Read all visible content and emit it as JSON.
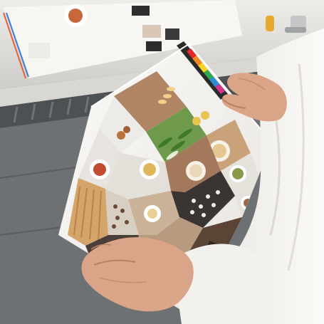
{
  "scene": {
    "description_tags": [
      "press-proof",
      "printed-sheet",
      "hands",
      "food-photography-collage"
    ],
    "palette": {
      "table_light": "#e9e7e3",
      "table_dark": "#5e6163",
      "sleeve": "#f3f1ee",
      "skin": "#d9a487",
      "skin_shadow": "#b97f63",
      "paper": "#f7f5f2",
      "wood": "#b08565",
      "wood_dark": "#8d6248",
      "slate": "#3a3533"
    },
    "color_bar": [
      "#e8262a",
      "#f08a24",
      "#f6d426",
      "#2fa84f",
      "#2a8fd6",
      "#5a3fa6",
      "#d6338c",
      "#1a1a1a",
      "#cfcfcf"
    ],
    "tiles": [
      {
        "name": "photo-tile-cutting-board",
        "color": "#b08565"
      },
      {
        "name": "photo-tile-white-plate",
        "color": "#ecebe8"
      },
      {
        "name": "photo-tile-green-leaves",
        "color": "#6f9a4c"
      },
      {
        "name": "photo-tile-pasta-bowl",
        "color": "#c9a27a"
      },
      {
        "name": "photo-tile-tomato-bowl",
        "color": "#e7e3de"
      },
      {
        "name": "photo-tile-nuts",
        "color": "#d8cfc3"
      },
      {
        "name": "photo-tile-slate-beans",
        "color": "#3a3533"
      },
      {
        "name": "photo-tile-soup-bowl",
        "color": "#e3dfd9"
      },
      {
        "name": "photo-tile-pasta-strands",
        "color": "#d3a56a"
      },
      {
        "name": "photo-tile-dark-board",
        "color": "#4a3f38"
      }
    ]
  }
}
